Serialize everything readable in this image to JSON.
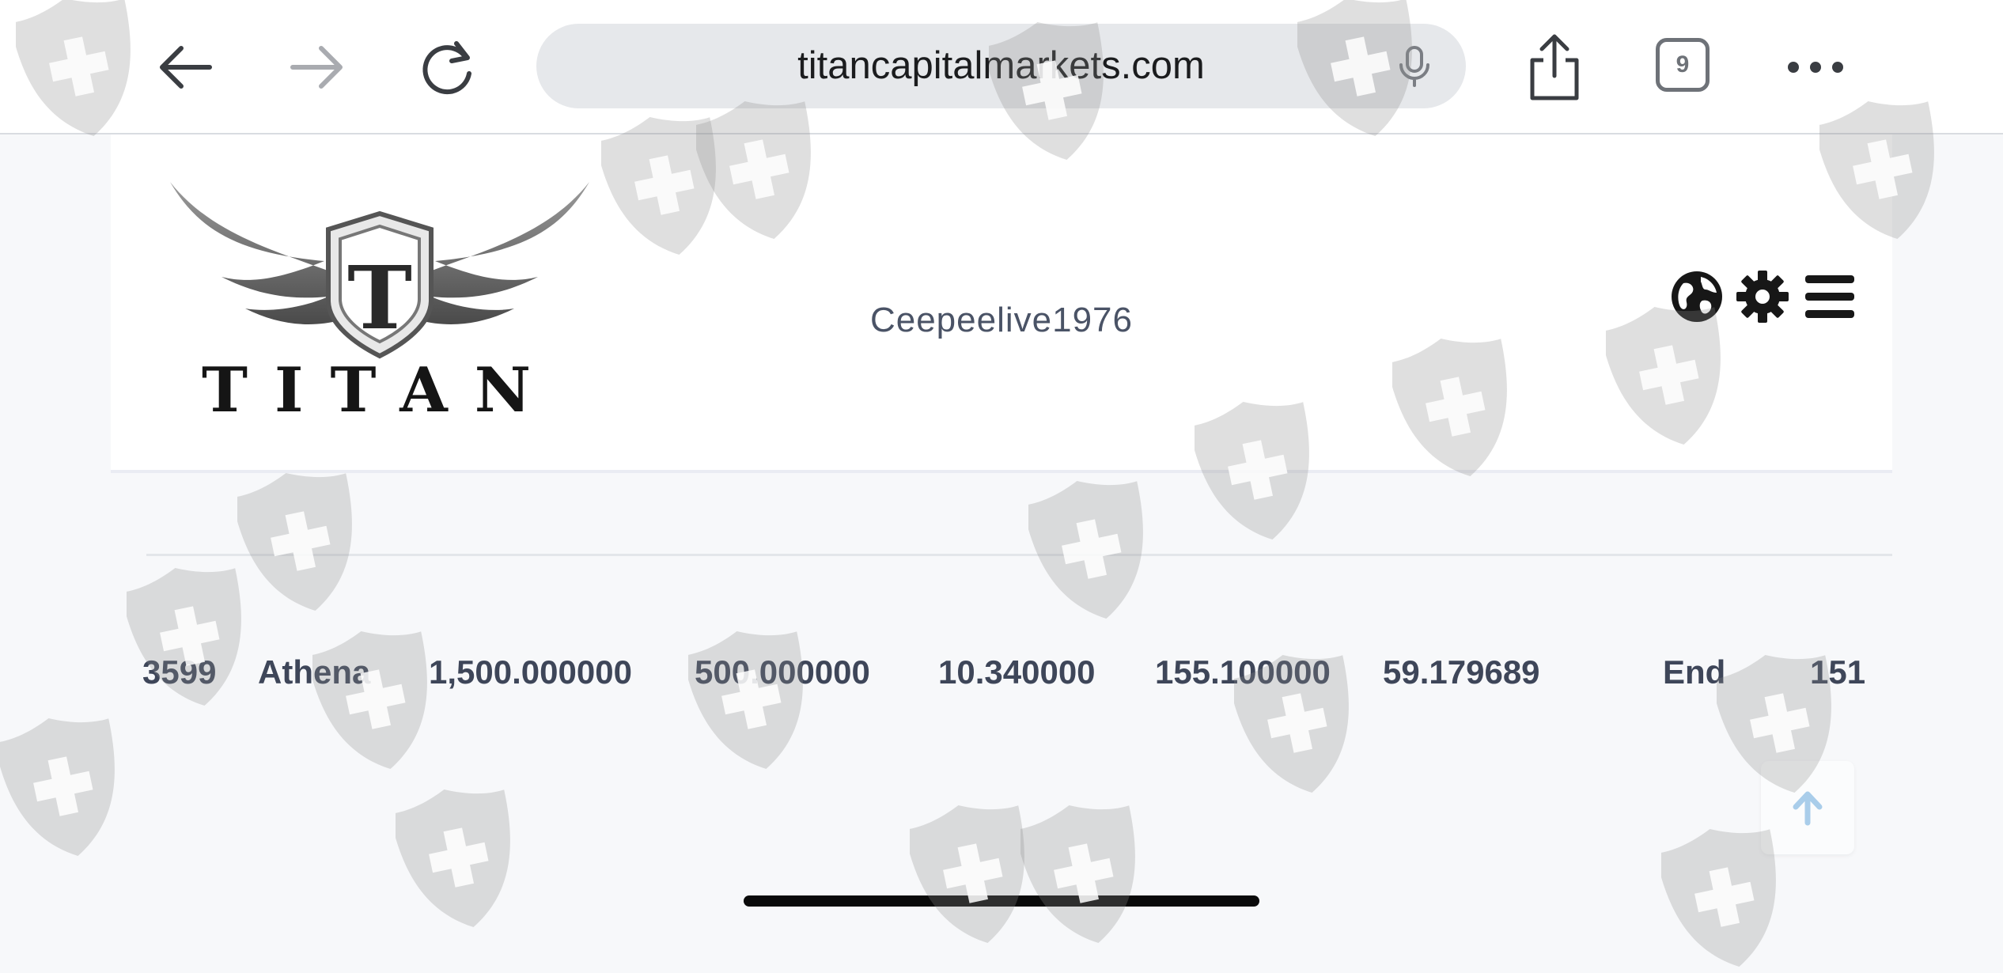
{
  "browser": {
    "url": "titancapitalmarkets.com",
    "tab_count": "9"
  },
  "header": {
    "logo_text": "TITAN",
    "username": "Ceepeelive1976"
  },
  "row": {
    "cells": [
      "3599",
      "Athena",
      "1,500.000000",
      "500.000000",
      "10.340000",
      "155.100000",
      "59.179689",
      "End",
      "151"
    ]
  },
  "colors": {
    "text_primary": "#3e4659",
    "accent_scroll": "#a9cdea"
  }
}
